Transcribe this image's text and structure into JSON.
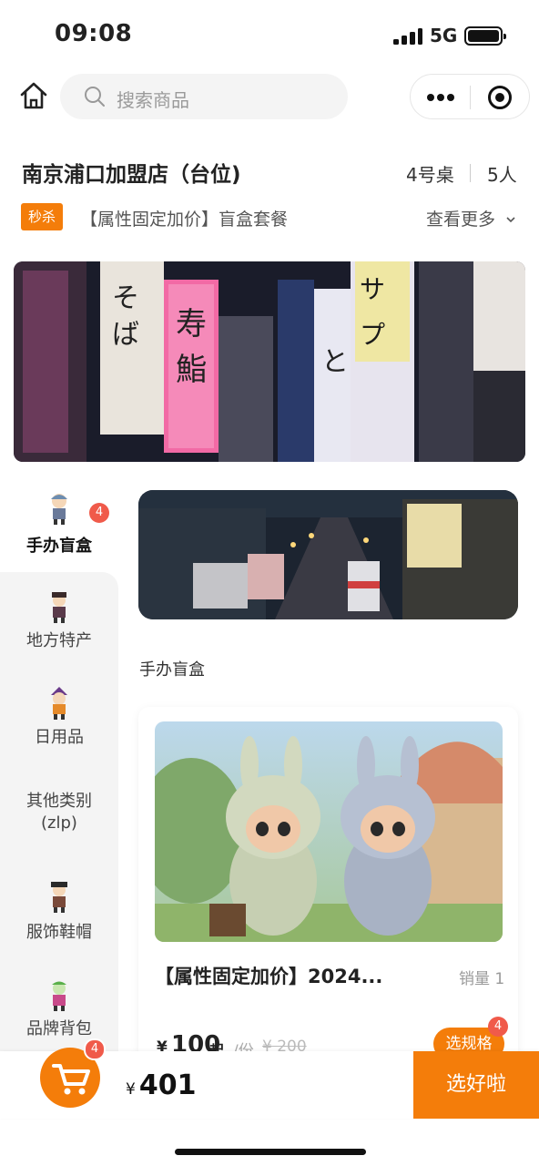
{
  "status": {
    "time": "09:08",
    "network": "5G"
  },
  "nav": {
    "search_placeholder": "搜索商品"
  },
  "store": {
    "name": "南京浦口加盟店（台位)",
    "table": "4号桌",
    "people": "5人"
  },
  "promo": {
    "tag": "秒杀",
    "text": "【属性固定加价】盲盒套餐",
    "more": "查看更多"
  },
  "categories": [
    {
      "label": "手办盲盒",
      "badge": "4"
    },
    {
      "label": "地方特产"
    },
    {
      "label": "日用品"
    },
    {
      "label": "其他类别",
      "label2": "(zlp)"
    },
    {
      "label": "服饰鞋帽"
    },
    {
      "label": "品牌背包"
    }
  ],
  "section": {
    "title": "手办盲盒"
  },
  "product": {
    "name": "【属性固定加价】2024...",
    "sales": "销量 1",
    "currency": "¥",
    "price": "100",
    "price_suffix": "起",
    "unit": "/份",
    "original_price": "¥ 200",
    "select_label": "选规格",
    "select_badge": "4"
  },
  "cart": {
    "badge": "4",
    "currency": "¥",
    "total": "401",
    "checkout": "选好啦"
  },
  "colors": {
    "accent": "#f47d0a",
    "badge": "#f05a4a"
  }
}
